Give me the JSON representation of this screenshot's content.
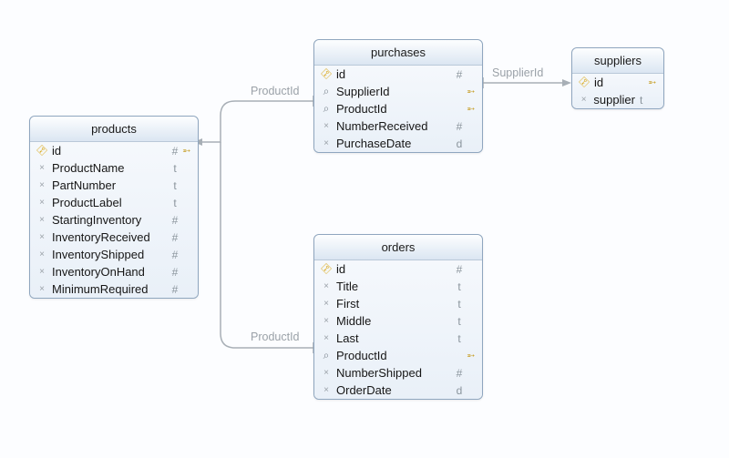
{
  "tables": {
    "products": {
      "title": "products",
      "cols": [
        {
          "name": "id",
          "type": "#",
          "icon": "key",
          "link": true
        },
        {
          "name": "ProductName",
          "type": "t",
          "icon": "ast"
        },
        {
          "name": "PartNumber",
          "type": "t",
          "icon": "ast"
        },
        {
          "name": "ProductLabel",
          "type": "t",
          "icon": "ast"
        },
        {
          "name": "StartingInventory",
          "type": "#",
          "icon": "ast"
        },
        {
          "name": "InventoryReceived",
          "type": "#",
          "icon": "ast"
        },
        {
          "name": "InventoryShipped",
          "type": "#",
          "icon": "ast"
        },
        {
          "name": "InventoryOnHand",
          "type": "#",
          "icon": "ast"
        },
        {
          "name": "MinimumRequired",
          "type": "#",
          "icon": "ast"
        }
      ]
    },
    "purchases": {
      "title": "purchases",
      "cols": [
        {
          "name": "id",
          "type": "#",
          "icon": "key"
        },
        {
          "name": "SupplierId",
          "type": "",
          "icon": "idx",
          "link": true
        },
        {
          "name": "ProductId",
          "type": "",
          "icon": "idx",
          "link": true
        },
        {
          "name": "NumberReceived",
          "type": "#",
          "icon": "ast"
        },
        {
          "name": "PurchaseDate",
          "type": "d",
          "icon": "ast"
        }
      ]
    },
    "suppliers": {
      "title": "suppliers",
      "cols": [
        {
          "name": "id",
          "type": "",
          "icon": "key",
          "link": true
        },
        {
          "name": "supplier",
          "type": "t",
          "icon": "ast"
        }
      ]
    },
    "orders": {
      "title": "orders",
      "cols": [
        {
          "name": "id",
          "type": "#",
          "icon": "key"
        },
        {
          "name": "Title",
          "type": "t",
          "icon": "ast"
        },
        {
          "name": "First",
          "type": "t",
          "icon": "ast"
        },
        {
          "name": "Middle",
          "type": "t",
          "icon": "ast"
        },
        {
          "name": "Last",
          "type": "t",
          "icon": "ast"
        },
        {
          "name": "ProductId",
          "type": "",
          "icon": "idx",
          "link": true
        },
        {
          "name": "NumberShipped",
          "type": "#",
          "icon": "ast"
        },
        {
          "name": "OrderDate",
          "type": "d",
          "icon": "ast"
        }
      ]
    }
  },
  "relationships": [
    {
      "from": "purchases.ProductId",
      "to": "products.id",
      "label": "ProductId"
    },
    {
      "from": "orders.ProductId",
      "to": "products.id",
      "label": "ProductId"
    },
    {
      "from": "purchases.SupplierId",
      "to": "suppliers.id",
      "label": "SupplierId"
    }
  ]
}
